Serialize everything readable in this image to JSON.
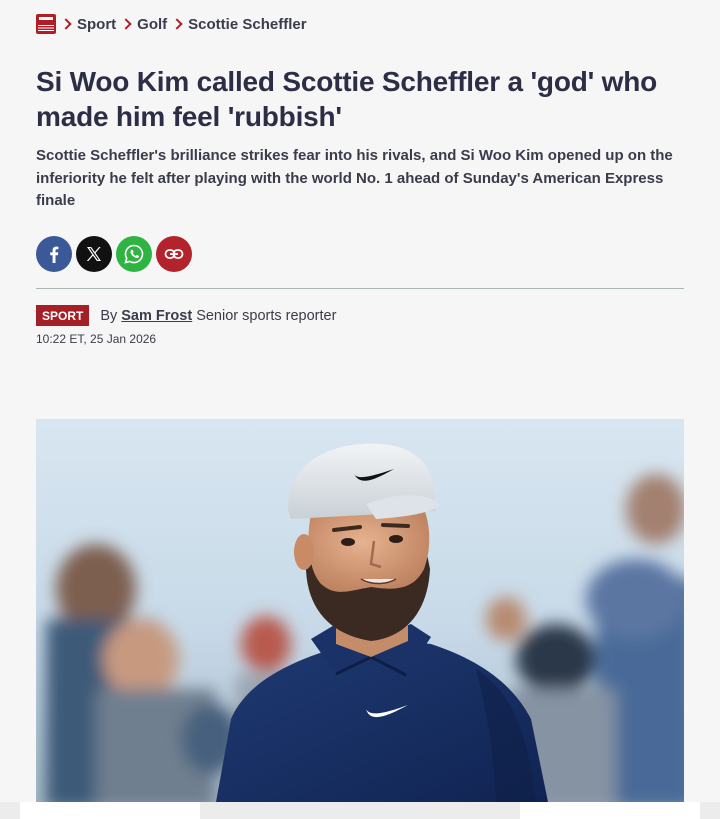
{
  "breadcrumb": {
    "logo_icon": "mirror-logo-icon",
    "items": [
      "Sport",
      "Golf",
      "Scottie Scheffler"
    ]
  },
  "article": {
    "title": "Si Woo Kim called Scottie Scheffler a 'god' who made him feel 'rubbish'",
    "standfirst": "Scottie Scheffler's brilliance strikes fear into his rivals, and Si Woo Kim opened up on the inferiority he felt after playing with the world No. 1 ahead of Sunday's American Express finale"
  },
  "share": {
    "icons": [
      "facebook-icon",
      "x-icon",
      "whatsapp-icon",
      "link-icon"
    ]
  },
  "byline": {
    "tag": "SPORT",
    "by": "By",
    "author": "Sam Frost",
    "role": "Senior sports reporter",
    "timestamp": "10:22 ET, 25 Jan 2026"
  },
  "colors": {
    "accent": "#b11d25",
    "title": "#2c2e45",
    "facebook": "#3b5998",
    "whatsapp": "#2fb343",
    "link": "#b3232b"
  }
}
